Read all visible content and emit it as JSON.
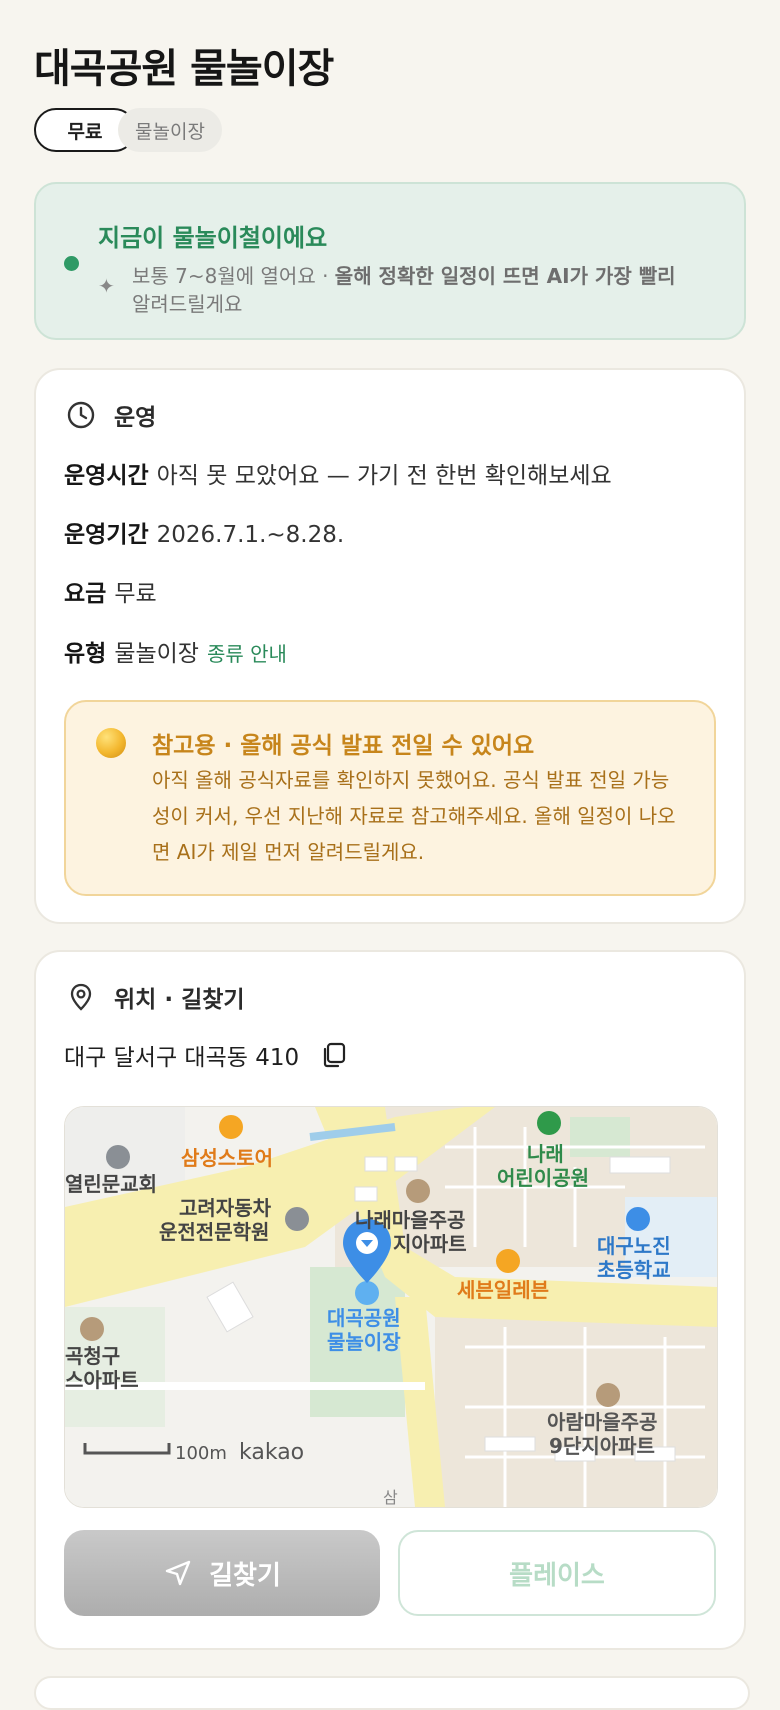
{
  "page": {
    "title": "대곡공원 물놀이장",
    "chips": [
      "무료",
      "물놀이장"
    ]
  },
  "season": {
    "title": "지금이 물놀이철이에요",
    "desc_plain": "보통 7~8월에 열어요 · ",
    "desc_bold": "올해 정확한 일정이 뜨면 AI가 가장 빨리",
    "desc_tail": "알려드릴게요"
  },
  "operation": {
    "section_label": "운영",
    "rows": [
      {
        "label": "운영시간",
        "value": "아직 못 모았어요 — 가기 전 한번 확인해보세요"
      },
      {
        "label": "운영기간",
        "value": "2026.7.1.~8.28."
      },
      {
        "label": "요금",
        "value": "무료"
      },
      {
        "label": "유형",
        "value": "물놀이장",
        "link": "종류 안내"
      }
    ],
    "notice": {
      "title": "참고용 · 올해 공식 발표 전일 수 있어요",
      "body": "아직 올해 공식자료를 확인하지 못했어요. 공식 발표 전일 가능성이 커서, 우선 지난해 자료로 참고해주세요. 올해 일정이 나오면 AI가 제일 먼저 알려드릴게요."
    }
  },
  "location": {
    "section_label": "위치 · 길찾기",
    "address": "대구 달서구 대곡동 410",
    "map": {
      "labels": {
        "samsung": "삼성스토어",
        "church": "열린문교회",
        "driving1": "고려자동차",
        "driving2": "운전전문학원",
        "narae_apt1": "나래마을주공",
        "narae_apt2": "지아파트",
        "narae_park1": "나래",
        "narae_park2": "어린이공원",
        "school1": "대구노진",
        "school2": "초등학교",
        "seven": "세븐일레븐",
        "target1": "대곡공원",
        "target2": "물놀이장",
        "cheonggu1": "곡청구",
        "cheonggu2": "스아파트",
        "aram1": "아람마을주공",
        "aram2": "9단지아파트",
        "scale": "100m",
        "brand": "kakao",
        "road": "삼"
      }
    },
    "buttons": {
      "route": "길찾기",
      "place": "플레이스"
    }
  },
  "colors": {
    "accent_green": "#2a8a5a",
    "notice_orange": "#c7851b",
    "pin_blue": "#3d8ee6"
  }
}
